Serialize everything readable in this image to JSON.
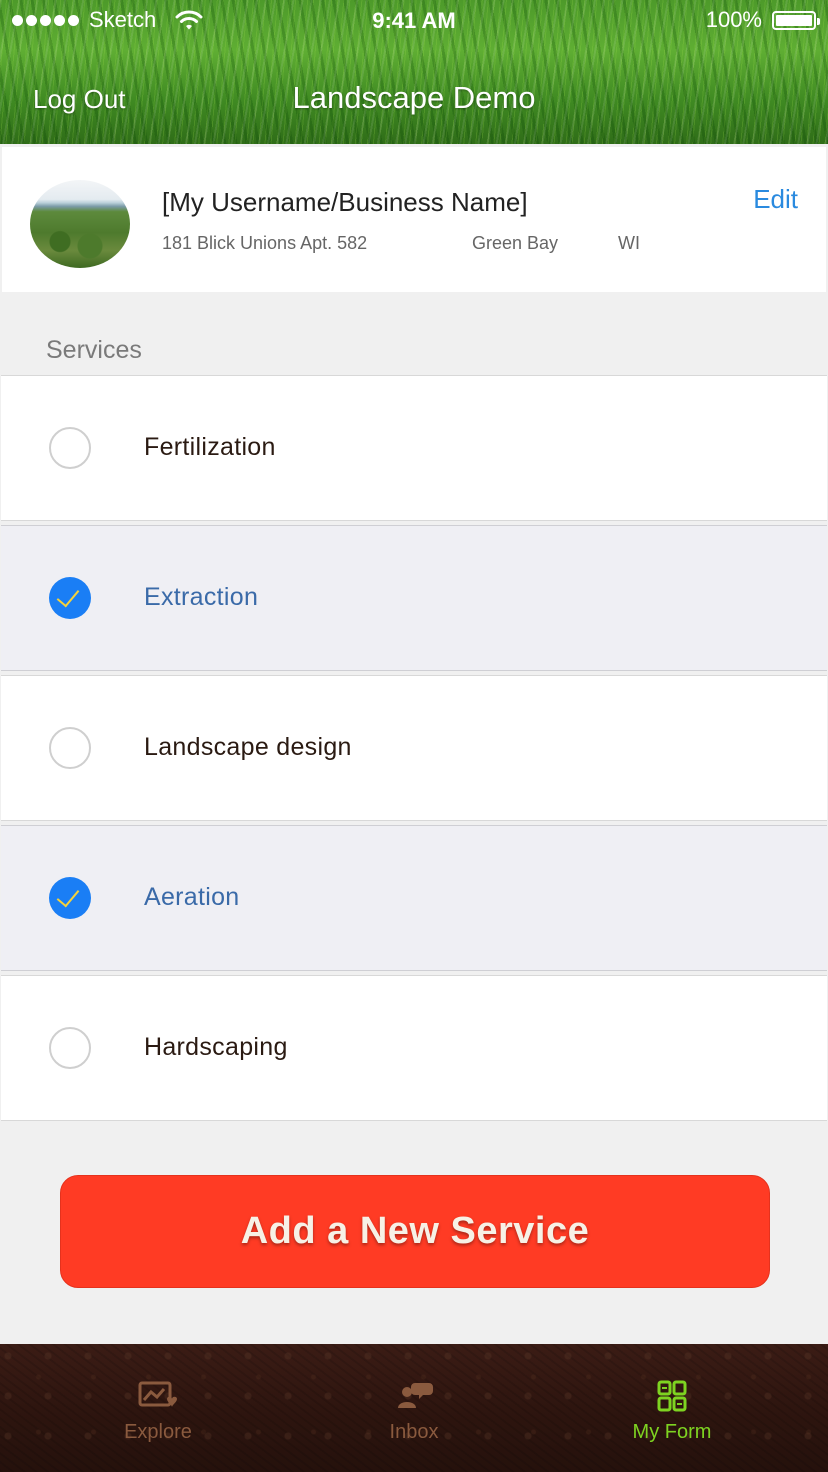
{
  "status_bar": {
    "carrier": "Sketch",
    "time": "9:41 AM",
    "battery": "100%",
    "battery_level": 1.0
  },
  "nav": {
    "left_button": "Log Out",
    "title": "Landscape Demo"
  },
  "profile": {
    "name": "[My Username/Business Name]",
    "address": "181 Blick Unions Apt. 582",
    "city": "Green Bay",
    "state": "WI",
    "edit_label": "Edit"
  },
  "services": {
    "section_label": "Services",
    "items": [
      {
        "label": "Fertilization",
        "selected": false
      },
      {
        "label": "Extraction",
        "selected": true
      },
      {
        "label": "Landscape design",
        "selected": false
      },
      {
        "label": "Aeration",
        "selected": true
      },
      {
        "label": "Hardscaping",
        "selected": false
      }
    ]
  },
  "add_button": {
    "label": "Add a New Service"
  },
  "tabs": [
    {
      "label": "Explore",
      "icon": "explore-icon",
      "active": false
    },
    {
      "label": "Inbox",
      "icon": "inbox-icon",
      "active": false
    },
    {
      "label": "My Form",
      "icon": "my-form-icon",
      "active": true
    }
  ],
  "colors": {
    "accent_blue": "#1a7ef5",
    "checkmark": "#f6d23a",
    "add_button": "#ff3b24",
    "active_tab": "#7ed321",
    "inactive_tab": "#8a5a3e"
  }
}
